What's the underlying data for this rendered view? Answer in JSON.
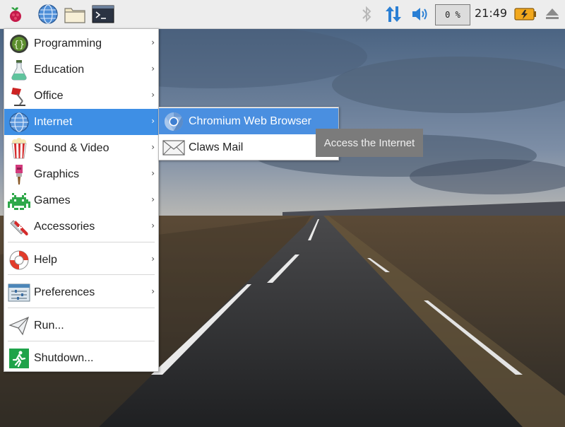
{
  "taskbar": {
    "launchers": [
      {
        "name": "raspberry-menu-icon"
      },
      {
        "name": "web-browser-icon"
      },
      {
        "name": "file-manager-icon"
      },
      {
        "name": "terminal-icon"
      }
    ],
    "tray": {
      "bluetooth_icon": "bluetooth-icon",
      "network_icon": "network-updown-icon",
      "volume_icon": "volume-icon",
      "cpu_usage": "0 %",
      "clock": "21:49",
      "battery_icon": "battery-charging-icon",
      "eject_icon": "eject-icon"
    }
  },
  "main_menu": {
    "items": [
      {
        "label": "Programming",
        "icon": "programming-icon",
        "submenu": true
      },
      {
        "label": "Education",
        "icon": "education-flask-icon",
        "submenu": true
      },
      {
        "label": "Office",
        "icon": "office-lamp-icon",
        "submenu": true
      },
      {
        "label": "Internet",
        "icon": "globe-icon",
        "submenu": true,
        "selected": true
      },
      {
        "label": "Sound & Video",
        "icon": "popcorn-icon",
        "submenu": true
      },
      {
        "label": "Graphics",
        "icon": "paintbrush-icon",
        "submenu": true
      },
      {
        "label": "Games",
        "icon": "space-invader-icon",
        "submenu": true
      },
      {
        "label": "Accessories",
        "icon": "swiss-knife-icon",
        "submenu": true
      },
      {
        "label": "Help",
        "icon": "lifebuoy-icon",
        "submenu": true
      },
      {
        "label": "Preferences",
        "icon": "preferences-sliders-icon",
        "submenu": true
      },
      {
        "label": "Run...",
        "icon": "paper-plane-icon",
        "submenu": false
      },
      {
        "label": "Shutdown...",
        "icon": "exit-running-man-icon",
        "submenu": false
      }
    ],
    "arrow": "›"
  },
  "submenu_internet": {
    "items": [
      {
        "label": "Chromium Web Browser",
        "icon": "chromium-icon",
        "selected": true
      },
      {
        "label": "Claws Mail",
        "icon": "envelope-icon"
      }
    ]
  },
  "tooltip": {
    "text": "Access the Internet"
  },
  "colors": {
    "menu_highlight": "#3e8fe5",
    "taskbar_bg": "#ededed",
    "tooltip_bg": "#7b7b7b",
    "network_arrow": "#2a7fd4",
    "battery": "#f2a81d"
  }
}
